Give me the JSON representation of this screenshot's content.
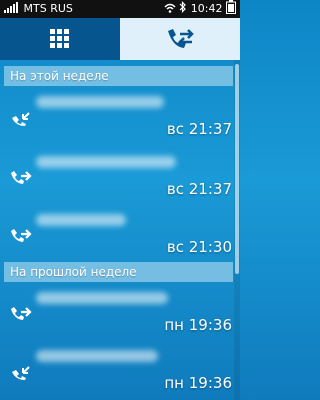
{
  "status_bar": {
    "carrier": "MTS RUS",
    "time": "10:42"
  },
  "tabs": [
    {
      "icon": "grid-icon",
      "active": true
    },
    {
      "icon": "call-log-icon",
      "active": false
    }
  ],
  "sections": {
    "this_week": {
      "title": "На этой неделе",
      "items": [
        {
          "type": "incoming",
          "time": "вс 21:37"
        },
        {
          "type": "outgoing",
          "time": "вс 21:37"
        },
        {
          "type": "outgoing",
          "time": "вс 21:30"
        }
      ]
    },
    "last_week": {
      "title": "На прошлой неделе",
      "items": [
        {
          "type": "outgoing",
          "time": "пн 19:36"
        },
        {
          "type": "incoming",
          "time": "пн 19:36"
        }
      ]
    }
  }
}
